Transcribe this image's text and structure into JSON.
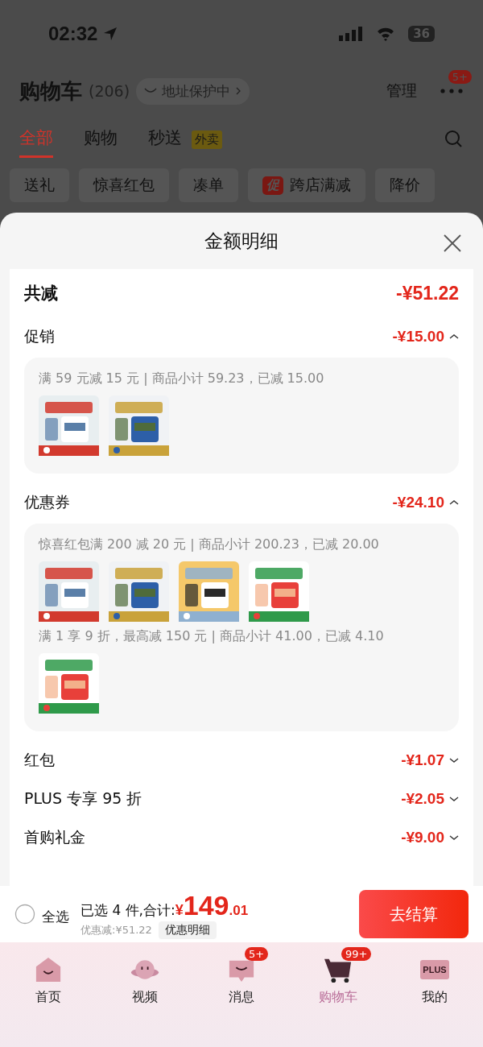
{
  "status_bar": {
    "time": "02:32",
    "battery": "36"
  },
  "header": {
    "title": "购物车",
    "count": "(206)",
    "address_chip": "地址保护中",
    "manage": "管理",
    "more_badge": "5+"
  },
  "tabs": [
    {
      "label": "全部",
      "selected": true
    },
    {
      "label": "购物",
      "selected": false
    },
    {
      "label": "秒送",
      "selected": false,
      "tag": "外卖"
    }
  ],
  "filters": [
    {
      "label": "送礼"
    },
    {
      "label": "惊喜红包"
    },
    {
      "label": "凑单"
    },
    {
      "label": "跨店满减",
      "tag": "促"
    },
    {
      "label": "降价"
    }
  ],
  "sheet": {
    "title": "金额明细",
    "rows": [
      {
        "kind": "total",
        "label": "共减",
        "amount": "-¥51.22"
      },
      {
        "kind": "item",
        "label": "促销",
        "amount": "-¥15.00",
        "expanded": true,
        "groups": [
          {
            "rule": "满 59 元减 15 元 | 商品小计 59.23，已减 15.00"
          }
        ]
      },
      {
        "kind": "item",
        "label": "优惠券",
        "amount": "-¥24.10",
        "expanded": true,
        "groups": [
          {
            "rule": "惊喜红包满 200 减 20 元 | 商品小计 200.23，已减 20.00"
          },
          {
            "rule": "满 1 享 9 折，最高减 150 元 | 商品小计 41.00，已减 4.10"
          }
        ]
      },
      {
        "kind": "item",
        "label": "红包",
        "amount": "-¥1.07",
        "expanded": false
      },
      {
        "kind": "item",
        "label": "PLUS 专享 95 折",
        "amount": "-¥2.05",
        "expanded": false
      },
      {
        "kind": "item",
        "label": "首购礼金",
        "amount": "-¥9.00",
        "expanded": false
      }
    ]
  },
  "checkout": {
    "select_all": "全选",
    "select_all_checked": false,
    "summary": "已选 4 件,合计:",
    "currency": "¥",
    "total_int": "149",
    "total_dec": ".01",
    "discount": "优惠减:¥51.22",
    "detail_button": "优惠明细",
    "button": "去结算"
  },
  "nav": [
    {
      "label": "首页",
      "selected": false
    },
    {
      "label": "视频",
      "selected": false
    },
    {
      "label": "消息",
      "selected": false,
      "badge": "5+"
    },
    {
      "label": "购物车",
      "selected": true,
      "badge": "99+"
    },
    {
      "label": "我的",
      "selected": false,
      "icon_text": "PLUS"
    }
  ]
}
